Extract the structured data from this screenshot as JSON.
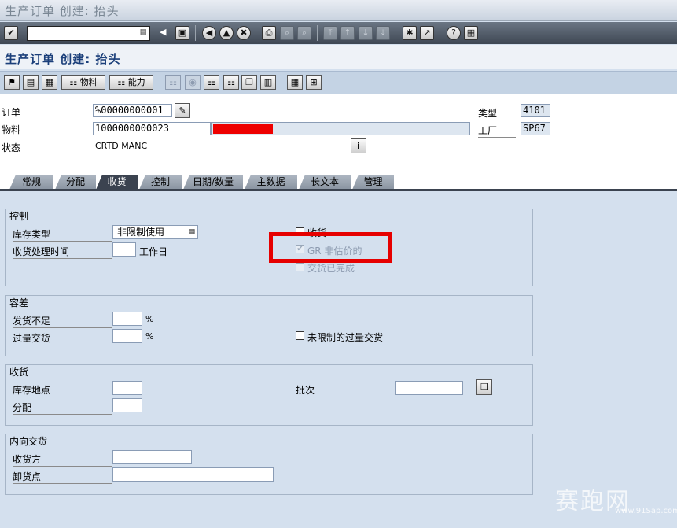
{
  "window_title": "生产订单 创建: 抬头",
  "screen_title": "生产订单 创建: 抬头",
  "app_toolbar": {
    "material_button": "物料",
    "capacity_button": "能力"
  },
  "header": {
    "order_label": "订单",
    "order_value": "%00000000001",
    "material_label": "物料",
    "material_value": "1000000000023",
    "status_label": "状态",
    "status_value": "CRTD  MANC",
    "type_label": "类型",
    "type_value": "4101",
    "plant_label": "工厂",
    "plant_value": "SP67"
  },
  "tabs": [
    "常规",
    "分配",
    "收货",
    "控制",
    "日期/数量",
    "主数据",
    "长文本",
    "管理"
  ],
  "active_tab": "收货",
  "control_group": {
    "title": "控制",
    "stock_type_label": "库存类型",
    "stock_type_value": "非限制使用",
    "gr_time_label": "收货处理时间",
    "gr_time_value": "",
    "workday_label": "工作日",
    "goods_receipt_label": "收货",
    "goods_receipt_checked": false,
    "gr_nonvaluated_label": "GR 非估价的",
    "gr_nonvaluated_checked": true,
    "delivery_completed_label": "交货已完成",
    "delivery_completed_checked": false
  },
  "tolerance_group": {
    "title": "容差",
    "underdelivery_label": "发货不足",
    "underdelivery_value": "",
    "overdelivery_label": "过量交货",
    "overdelivery_value": "",
    "percent": "%",
    "unlimited_overdelivery_label": "未限制的过量交货",
    "unlimited_overdelivery_checked": false
  },
  "gr_group": {
    "title": "收货",
    "storage_location_label": "库存地点",
    "storage_location_value": "",
    "distribution_label": "分配",
    "distribution_value": "",
    "batch_label": "批次",
    "batch_value": ""
  },
  "inbound_group": {
    "title": "内向交货",
    "recipient_label": "收货方",
    "recipient_value": "",
    "unloading_point_label": "卸货点",
    "unloading_point_value": ""
  },
  "watermark": {
    "text": "赛跑网",
    "url": "www.91Sap.com"
  },
  "colors": {
    "highlight_red": "#e60000",
    "screen_bg": "#d4e0ee",
    "title_blue": "#1b3f7a"
  }
}
